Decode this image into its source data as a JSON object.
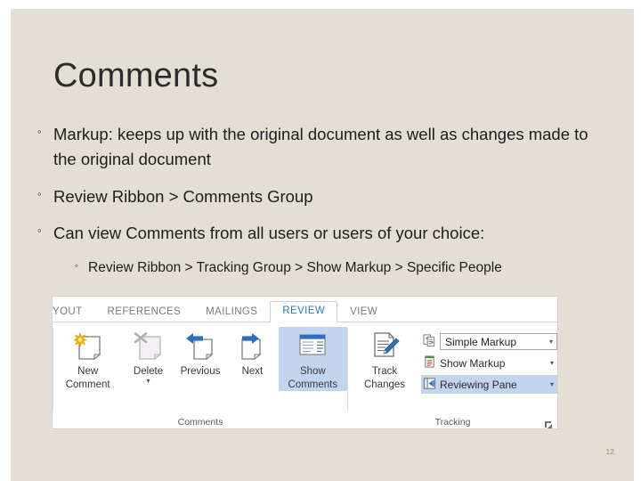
{
  "slide": {
    "title": "Comments",
    "page_number": "12",
    "background_color": "#e4dfd5"
  },
  "bullets": [
    {
      "level": 1,
      "marker": "◦",
      "text": "Markup: keeps up with the original document as well as changes made to the original document"
    },
    {
      "level": 1,
      "marker": "◦",
      "text": "Review Ribbon > Comments Group"
    },
    {
      "level": 1,
      "marker": "◦",
      "text": "Can view Comments from all users or users of your choice:"
    },
    {
      "level": 2,
      "marker": "◦",
      "text": "Review Ribbon > Tracking Group > Show Markup > Specific People"
    }
  ],
  "ribbon": {
    "accent_color": "#2e75b6",
    "selected_color": "#c3d4ef",
    "tabs": [
      {
        "label": "YOUT",
        "active": false,
        "clipped": true
      },
      {
        "label": "REFERENCES",
        "active": false
      },
      {
        "label": "MAILINGS",
        "active": false
      },
      {
        "label": "REVIEW",
        "active": true
      },
      {
        "label": "VIEW",
        "active": false
      }
    ],
    "groups": [
      {
        "name": "comments",
        "label": "Comments",
        "buttons": [
          {
            "id": "new-comment",
            "icon": "new-comment-icon",
            "line1": "New",
            "line2": "Comment",
            "disabled": false,
            "selected": false,
            "dropdown": false
          },
          {
            "id": "delete-comment",
            "icon": "delete-comment-icon",
            "line1": "Delete",
            "line2": "",
            "disabled": true,
            "selected": false,
            "dropdown": true
          },
          {
            "id": "previous-comment",
            "icon": "previous-comment-icon",
            "line1": "Previous",
            "line2": "",
            "disabled": true,
            "selected": false,
            "dropdown": false
          },
          {
            "id": "next-comment",
            "icon": "next-comment-icon",
            "line1": "Next",
            "line2": "",
            "disabled": false,
            "selected": false,
            "dropdown": false
          },
          {
            "id": "show-comments",
            "icon": "show-comments-icon",
            "line1": "Show",
            "line2": "Comments",
            "disabled": false,
            "selected": true,
            "dropdown": false
          }
        ]
      },
      {
        "name": "tracking",
        "label": "Tracking",
        "big_button": {
          "id": "track-changes",
          "icon": "track-changes-icon",
          "line1": "Track",
          "line2": "Changes",
          "dropdown": true
        },
        "rows": [
          {
            "id": "markup-display",
            "icon": "markup-compare-icon",
            "label": "Simple Markup",
            "type": "combo",
            "selected": false,
            "dropdown": true
          },
          {
            "id": "show-markup",
            "icon": "show-markup-icon",
            "label": "Show Markup",
            "type": "plain",
            "selected": false,
            "dropdown": true
          },
          {
            "id": "reviewing-pane",
            "icon": "reviewing-pane-icon",
            "label": "Reviewing Pane",
            "type": "plain",
            "selected": true,
            "dropdown": true
          }
        ],
        "dialog_launcher": "dialog-launcher-icon"
      }
    ]
  }
}
